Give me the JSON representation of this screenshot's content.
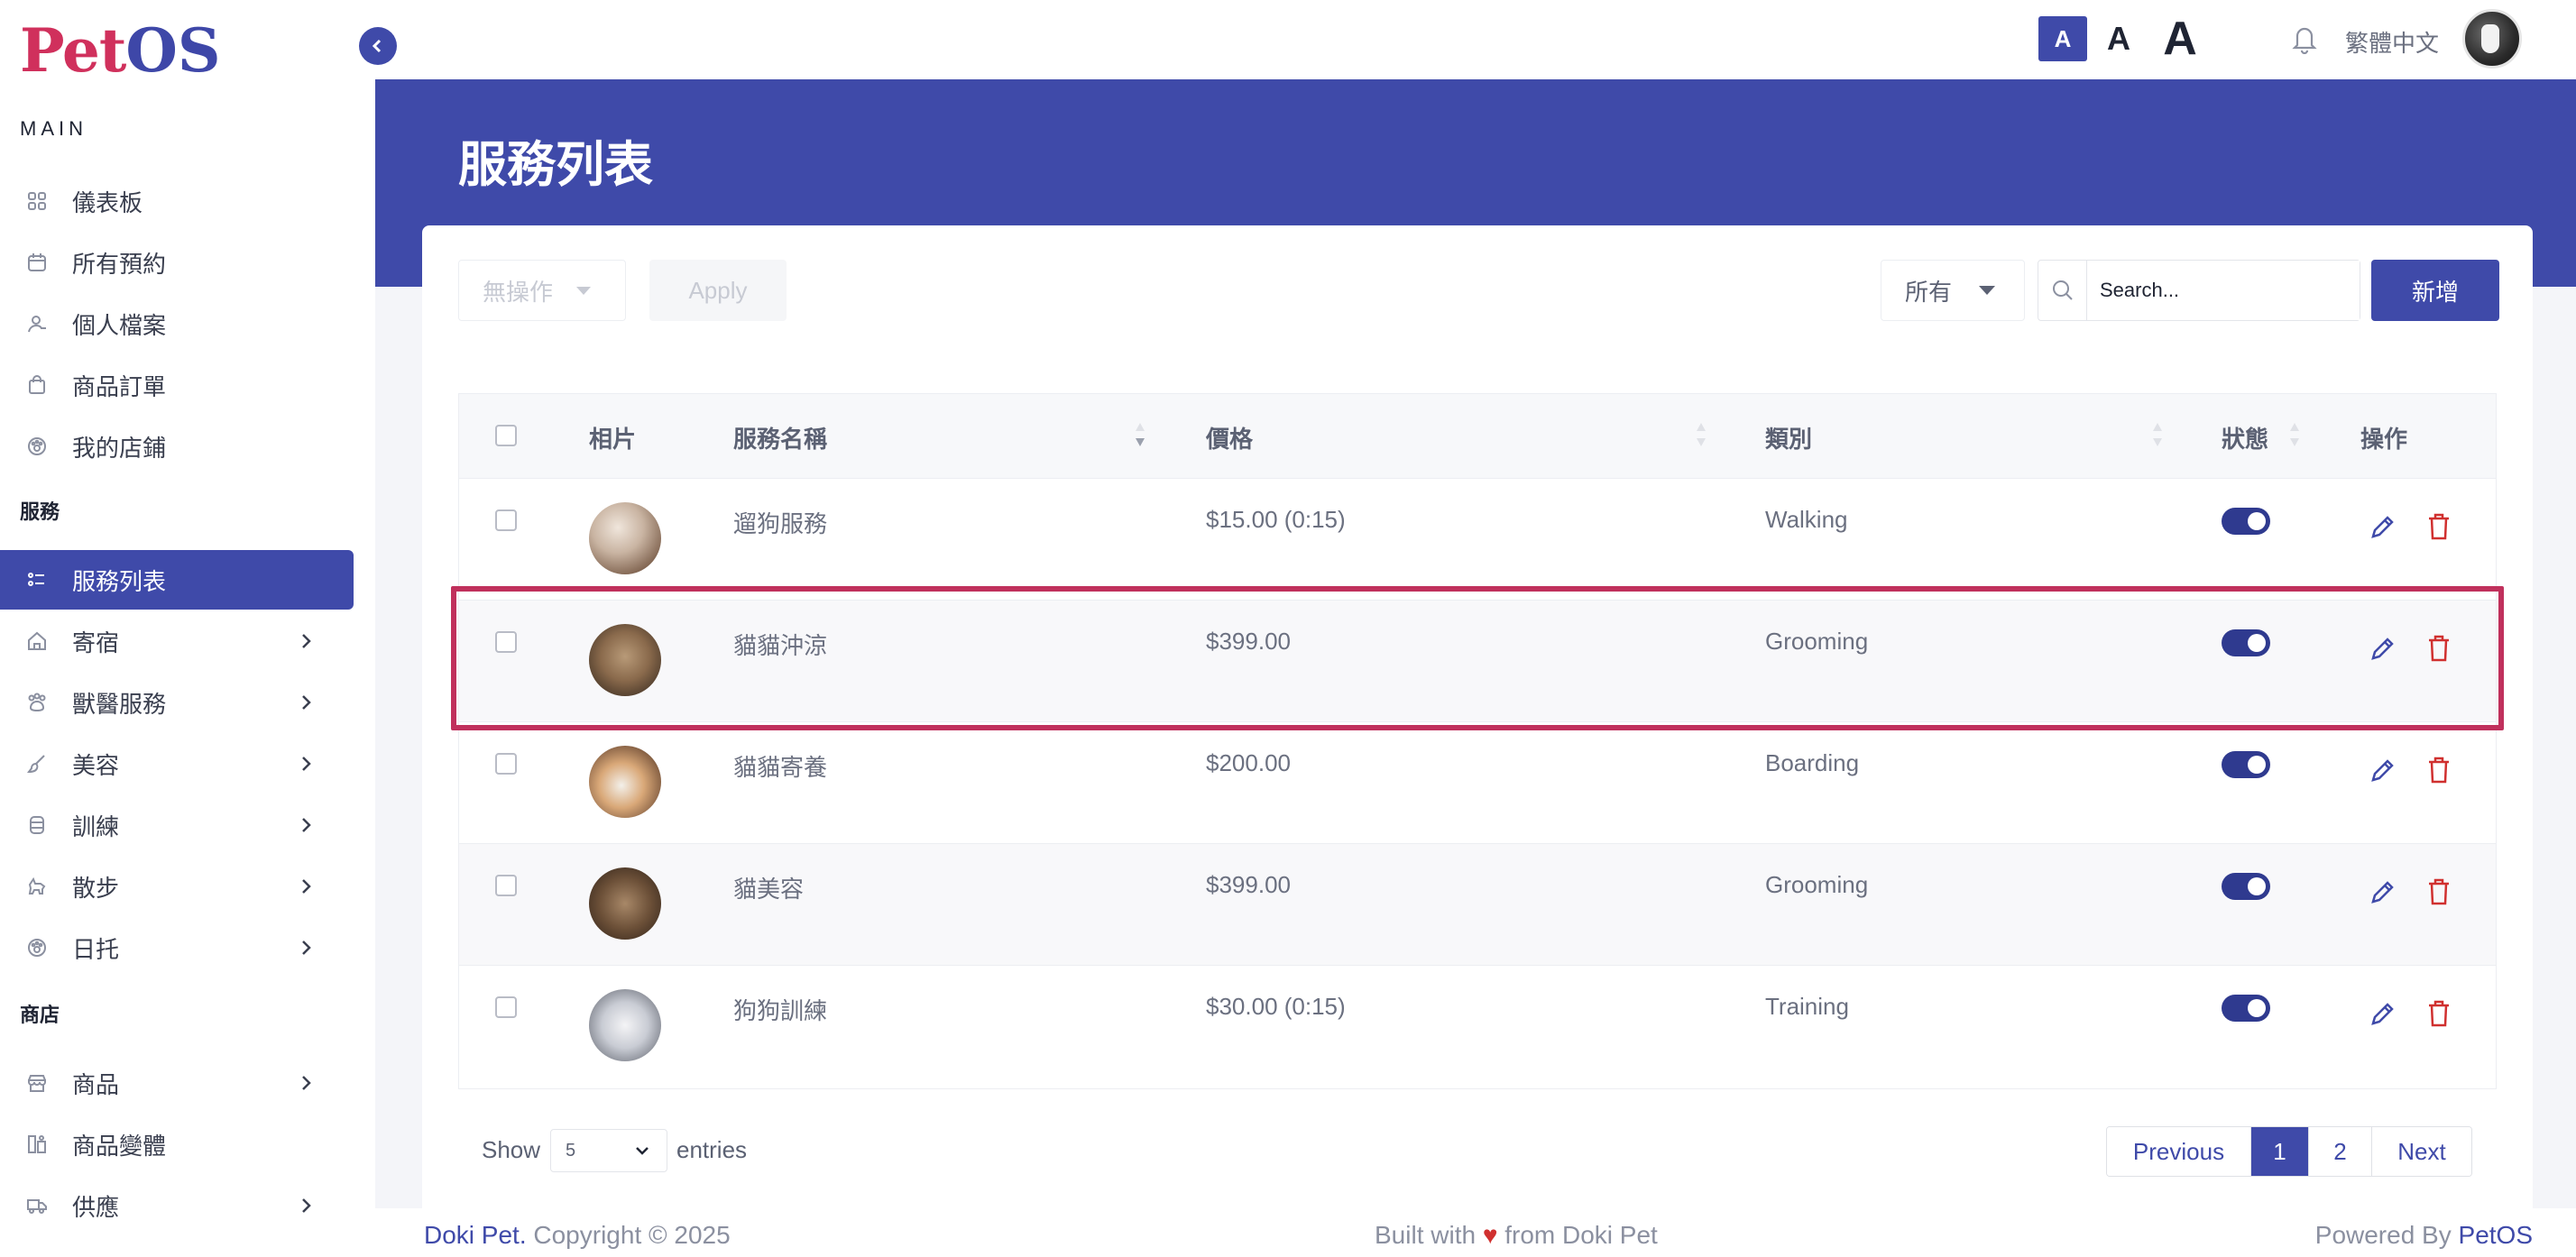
{
  "logo": {
    "part1": "Pet",
    "part2": "OS"
  },
  "sidebar": {
    "main_title": "MAIN",
    "main_items": [
      {
        "label": "儀表板",
        "icon": "grid-icon"
      },
      {
        "label": "所有預約",
        "icon": "calendar-icon"
      },
      {
        "label": "個人檔案",
        "icon": "user-icon"
      },
      {
        "label": "商品訂單",
        "icon": "bag-icon"
      },
      {
        "label": "我的店鋪",
        "icon": "paw-icon"
      }
    ],
    "service_title": "服務",
    "service_items": [
      {
        "label": "服務列表",
        "icon": "list-icon",
        "active": true
      },
      {
        "label": "寄宿",
        "icon": "house-icon"
      },
      {
        "label": "獸醫服務",
        "icon": "paws-icon"
      },
      {
        "label": "美容",
        "icon": "brush-icon"
      },
      {
        "label": "訓練",
        "icon": "training-icon"
      },
      {
        "label": "散步",
        "icon": "dog-walk-icon"
      },
      {
        "label": "日托",
        "icon": "paw-icon"
      }
    ],
    "shop_title": "商店",
    "shop_items": [
      {
        "label": "商品",
        "icon": "store-icon"
      },
      {
        "label": "商品變體",
        "icon": "variants-icon"
      },
      {
        "label": "供應",
        "icon": "truck-icon"
      }
    ]
  },
  "topbar": {
    "font_small": "A",
    "font_medium": "A",
    "font_large": "A",
    "language": "繁體中文"
  },
  "page": {
    "title": "服務列表"
  },
  "toolbar": {
    "bulk_action": "無操作",
    "apply": "Apply",
    "filter": "所有",
    "search_placeholder": "Search...",
    "add": "新增"
  },
  "table": {
    "columns": [
      "相片",
      "服務名稱",
      "價格",
      "類別",
      "狀態",
      "操作"
    ],
    "rows": [
      {
        "name": "遛狗服務",
        "price": "$15.00 (0:15)",
        "category": "Walking",
        "enabled": true
      },
      {
        "name": "貓貓沖涼",
        "price": "$399.00",
        "category": "Grooming",
        "enabled": true
      },
      {
        "name": "貓貓寄養",
        "price": "$200.00",
        "category": "Boarding",
        "enabled": true
      },
      {
        "name": "貓美容",
        "price": "$399.00",
        "category": "Grooming",
        "enabled": true
      },
      {
        "name": "狗狗訓練",
        "price": "$30.00 (0:15)",
        "category": "Training",
        "enabled": true
      }
    ]
  },
  "pagination": {
    "show": "Show",
    "page_size": "5",
    "entries": "entries",
    "previous": "Previous",
    "page1": "1",
    "page2": "2",
    "next": "Next"
  },
  "footer": {
    "brand": "Doki Pet.",
    "copyright": " Copyright © 2025",
    "built_prefix": "Built with ",
    "heart": "♥",
    "built_suffix": " from Doki Pet",
    "powered_prefix": "Powered By ",
    "powered_brand": "PetOS"
  },
  "colors": {
    "primary": "#3f4aa9",
    "brand_red": "#d0305c",
    "delete": "#d0302f"
  }
}
